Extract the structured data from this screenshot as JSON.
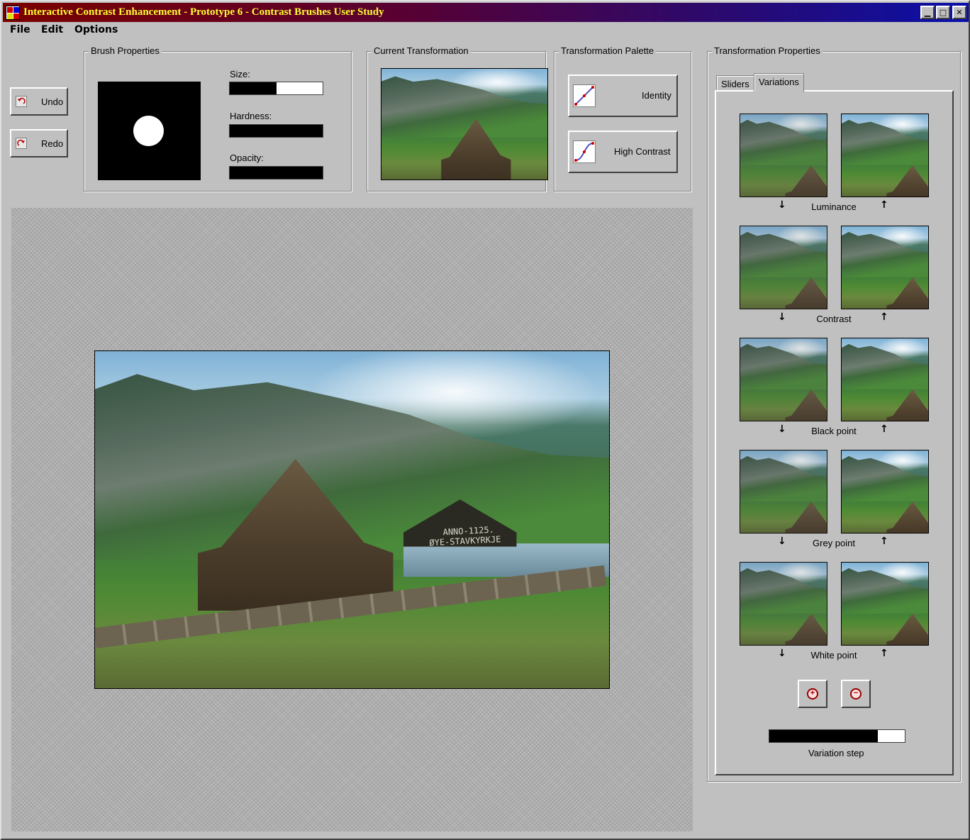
{
  "window": {
    "title": "Interactive Contrast Enhancement - Prototype 6 - Contrast Brushes User Study",
    "controls": {
      "minimize": "▁",
      "maximize": "□",
      "close": "✕"
    }
  },
  "menu": [
    "File",
    "Edit",
    "Options"
  ],
  "history": {
    "undo_label": "Undo",
    "redo_label": "Redo"
  },
  "brush_properties": {
    "title": "Brush Properties",
    "size_label": "Size:",
    "size_value": 0.5,
    "hardness_label": "Hardness:",
    "hardness_value": 1.0,
    "opacity_label": "Opacity:",
    "opacity_value": 1.0
  },
  "current_transformation": {
    "title": "Current Transformation"
  },
  "transformation_palette": {
    "title": "Transformation Palette",
    "items": [
      "Identity",
      "High Contrast"
    ]
  },
  "transformation_properties": {
    "title": "Transformation Properties",
    "tabs": [
      "Sliders",
      "Variations"
    ],
    "active_tab": "Variations",
    "variations": [
      "Luminance",
      "Contrast",
      "Black point",
      "Grey point",
      "White point"
    ],
    "decrease_icon": "↓",
    "increase_icon": "↑",
    "zoom_in_icon": "+",
    "zoom_out_icon": "−",
    "variation_step_label": "Variation step",
    "variation_step_value": 0.8
  },
  "photo_sign": {
    "line1": "ANNO-1125.",
    "line2": "ØYE-STAVKYRKJE"
  }
}
